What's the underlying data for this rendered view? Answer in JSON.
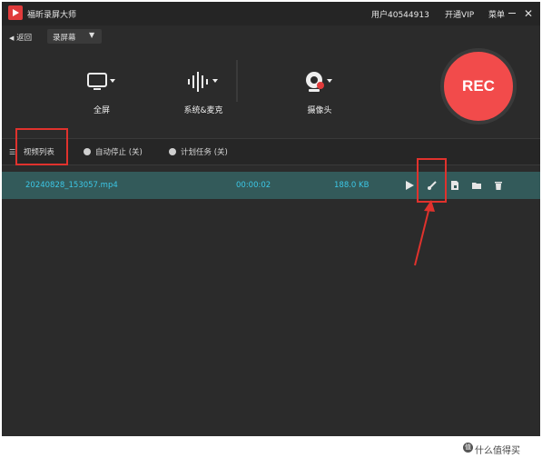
{
  "titlebar": {
    "app_title": "福昕录屏大师",
    "user_id": "用户40544913",
    "vip_label": "开通VIP",
    "menu_label": "菜单"
  },
  "subbar": {
    "back_label": "返回",
    "mode_label": "录屏幕"
  },
  "tools": {
    "fullscreen_label": "全屏",
    "audio_label": "系统&麦克",
    "camera_label": "摄像头"
  },
  "rec_label": "REC",
  "tabs": {
    "video_list": "视频列表",
    "auto_stop": "自动停止 (关)",
    "schedule": "计划任务 (关)"
  },
  "recordings": [
    {
      "filename": "20240828_153057.mp4",
      "duration": "00:00:02",
      "size": "188.0 KB"
    }
  ],
  "watermark": "什么值得买",
  "colors": {
    "accent": "#f24b4b",
    "row_text": "#3cc7e6",
    "highlight": "#e0322d"
  }
}
